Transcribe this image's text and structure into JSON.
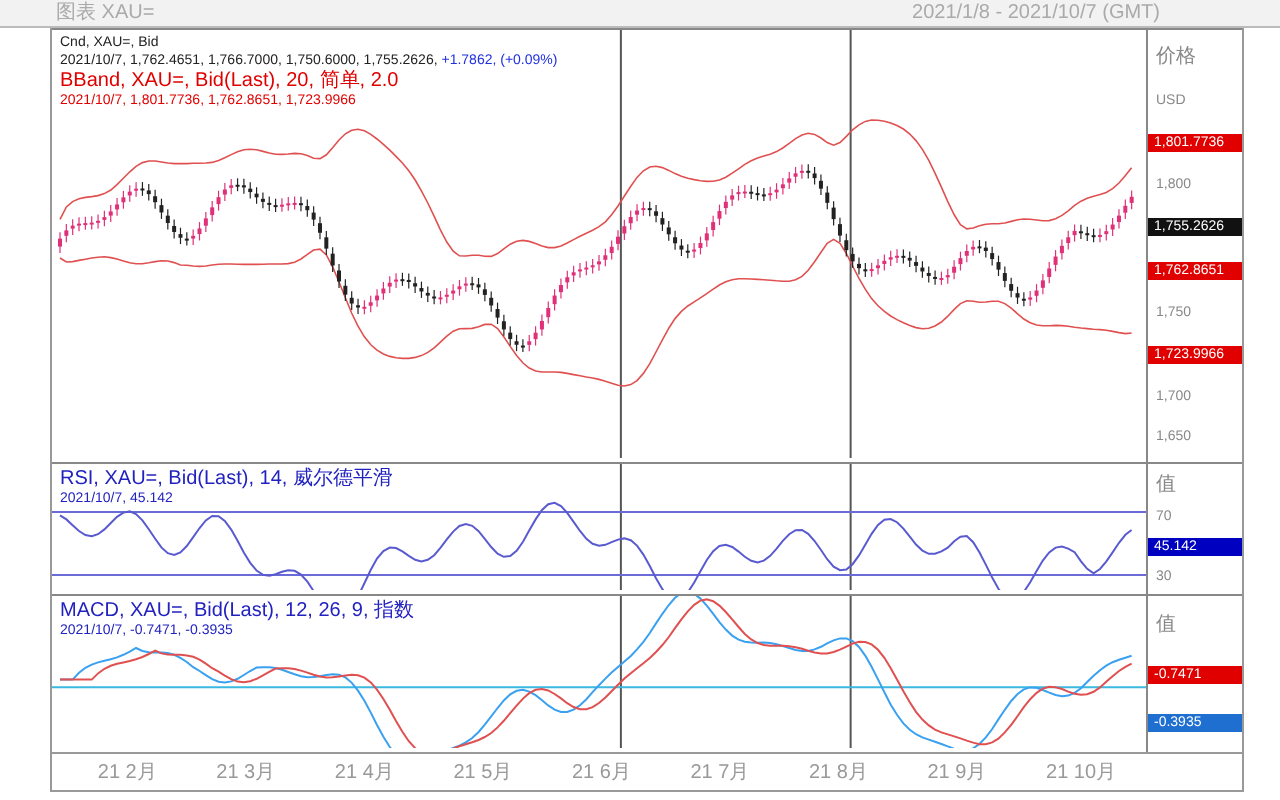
{
  "header": {
    "title": "图表 XAU=",
    "range": "2021/1/8 - 2021/10/7 (GMT)"
  },
  "panels": [
    {
      "kind": "price",
      "legend": [
        {
          "kind": "main",
          "text": "Cnd, XAU=, Bid"
        },
        {
          "kind": "main",
          "text": "2021/10/7, 1,762.4651, 1,766.7000, 1,750.6000, 1,755.2626,",
          "change": "+1.7862, (+0.09%)"
        },
        {
          "kind": "band",
          "text": "BBand, XAU=, Bid(Last), 20, 简单, 2.0"
        },
        {
          "kind": "band",
          "text": "2021/10/7, 1,801.7736, 1,762.8651, 1,723.9966"
        }
      ],
      "axis": [
        {
          "kind": "label",
          "text": "价格"
        },
        {
          "kind": "label",
          "text": "USD"
        },
        {
          "kind": "tag",
          "text": "1,801.7736",
          "color": "#e00000"
        },
        {
          "kind": "tick",
          "text": "1,800"
        },
        {
          "kind": "tag",
          "text": "1,755.2626",
          "color": "#111111"
        },
        {
          "kind": "tag",
          "text": "1,762.8651",
          "color": "#e00000"
        },
        {
          "kind": "tick",
          "text": "1,750"
        },
        {
          "kind": "tag",
          "text": "1,723.9966",
          "color": "#e00000"
        },
        {
          "kind": "tick",
          "text": "1,700"
        },
        {
          "kind": "tick",
          "text": "1,650"
        }
      ]
    },
    {
      "kind": "rsi",
      "legend": [
        {
          "kind": "rsi",
          "text": "RSI, XAU=, Bid(Last), 14, 威尔德平滑"
        },
        {
          "kind": "rsi",
          "text": "2021/10/7, 45.142"
        }
      ],
      "axis": [
        {
          "kind": "label",
          "text": "值"
        },
        {
          "kind": "tick",
          "text": "70"
        },
        {
          "kind": "tag",
          "text": "45.142",
          "color": "#0000c0"
        },
        {
          "kind": "tick",
          "text": "30"
        }
      ]
    },
    {
      "kind": "macd",
      "legend": [
        {
          "kind": "rsi",
          "text": "MACD, XAU=, Bid(Last), 12, 26, 9, 指数"
        },
        {
          "kind": "rsi",
          "text": "2021/10/7, -0.7471, -0.3935"
        }
      ],
      "axis": [
        {
          "kind": "label",
          "text": "值"
        },
        {
          "kind": "tag",
          "text": "-0.7471",
          "color": "#e00000"
        },
        {
          "kind": "tag",
          "text": "-0.3935",
          "color": "#1e6fd0"
        }
      ]
    }
  ],
  "months": [
    "21 2月",
    "21 3月",
    "21 4月",
    "21 5月",
    "21 6月",
    "21 7月",
    "21 8月",
    "21 9月",
    "21 10月"
  ]
}
